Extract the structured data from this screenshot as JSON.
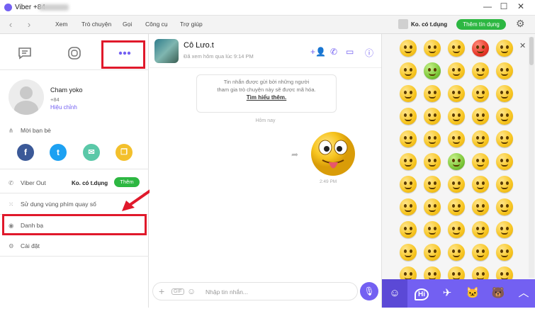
{
  "window": {
    "title": "Viber +84",
    "minimize": "—",
    "maximize": "☐",
    "close": "✕"
  },
  "toolbar": {
    "back": "‹",
    "forward": "›",
    "menu": [
      "Xem",
      "Trò chuyện",
      "Gọi",
      "Công cụ",
      "Trợ giúp"
    ],
    "status": "Ko. có t.dụng",
    "add_credit": "Thêm tín dụng"
  },
  "sidebar": {
    "profile_name": "Cham yoko",
    "profile_phone": "+84",
    "edit_label": "Hiệu chỉnh",
    "invite_label": "Mời bạn bè",
    "viber_out_label": "Viber Out",
    "viber_out_balance": "Ko. có t.dụng",
    "viber_out_add": "Thêm",
    "dialpad_label": "Sử dụng vùng phím quay số",
    "contacts_label": "Danh bạ",
    "settings_label": "Cài đặt"
  },
  "chat": {
    "name": "Cô Lưo.t",
    "last_seen": "Đã xem hôm qua lúc 9:14 PM",
    "encryption_notice_1": "Tin nhắn được gửi bởi những người",
    "encryption_notice_2": "tham gia trò chuyện này sẽ được mã hóa.",
    "learn_more": "Tìm hiểu thêm.",
    "date_separator": "Hôm nay",
    "message_time": "2:49 PM",
    "composer_placeholder": "Nhập tin nhắn..."
  },
  "colors": {
    "accent": "#7360f2",
    "green": "#2db742",
    "highlight": "#e0192b"
  }
}
